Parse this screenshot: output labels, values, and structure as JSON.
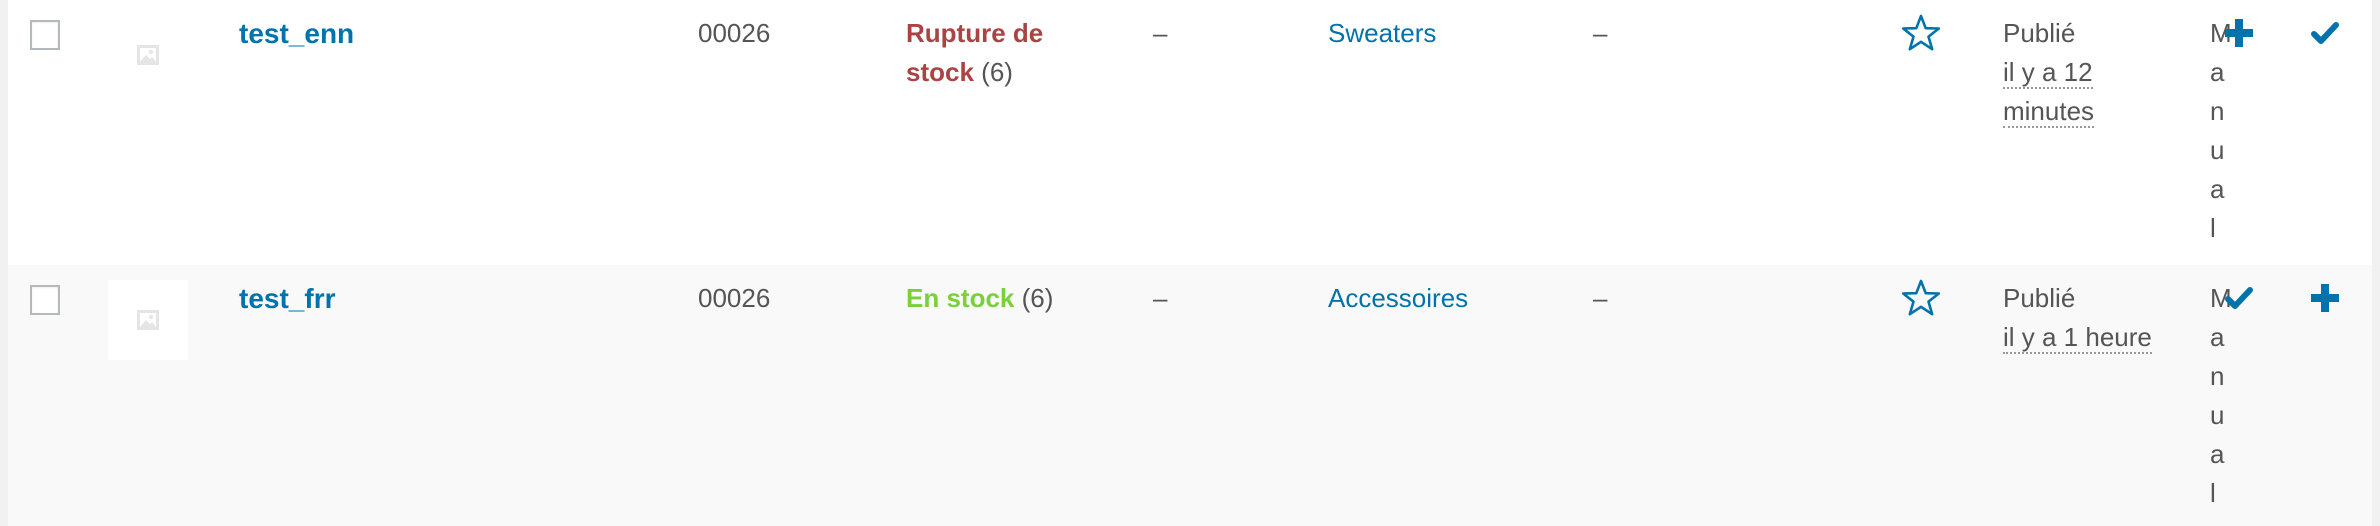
{
  "rows": [
    {
      "name": "test_enn",
      "sku": "00026",
      "stock_status": "Rupture de stock",
      "stock_qty": "(6)",
      "price": "–",
      "category": "Sweaters",
      "tags": "–",
      "status": "Publié",
      "date_ago": "il y a 12 minutes",
      "type_letters": [
        "M",
        "a",
        "n",
        "u",
        "a",
        "l"
      ]
    },
    {
      "name": "test_frr",
      "sku": "00026",
      "stock_status": "En stock",
      "stock_qty": "(6)",
      "price": "–",
      "category": "Accessoires",
      "tags": "–",
      "status": "Publié",
      "date_ago": "il y a 1 heure",
      "type_letters": [
        "M",
        "a",
        "n",
        "u",
        "a",
        "l"
      ]
    }
  ],
  "colors": {
    "link": "#0073aa",
    "out_of_stock": "#aa4444",
    "in_stock": "#7ad03a",
    "row_alt": "#f9f9f9"
  }
}
